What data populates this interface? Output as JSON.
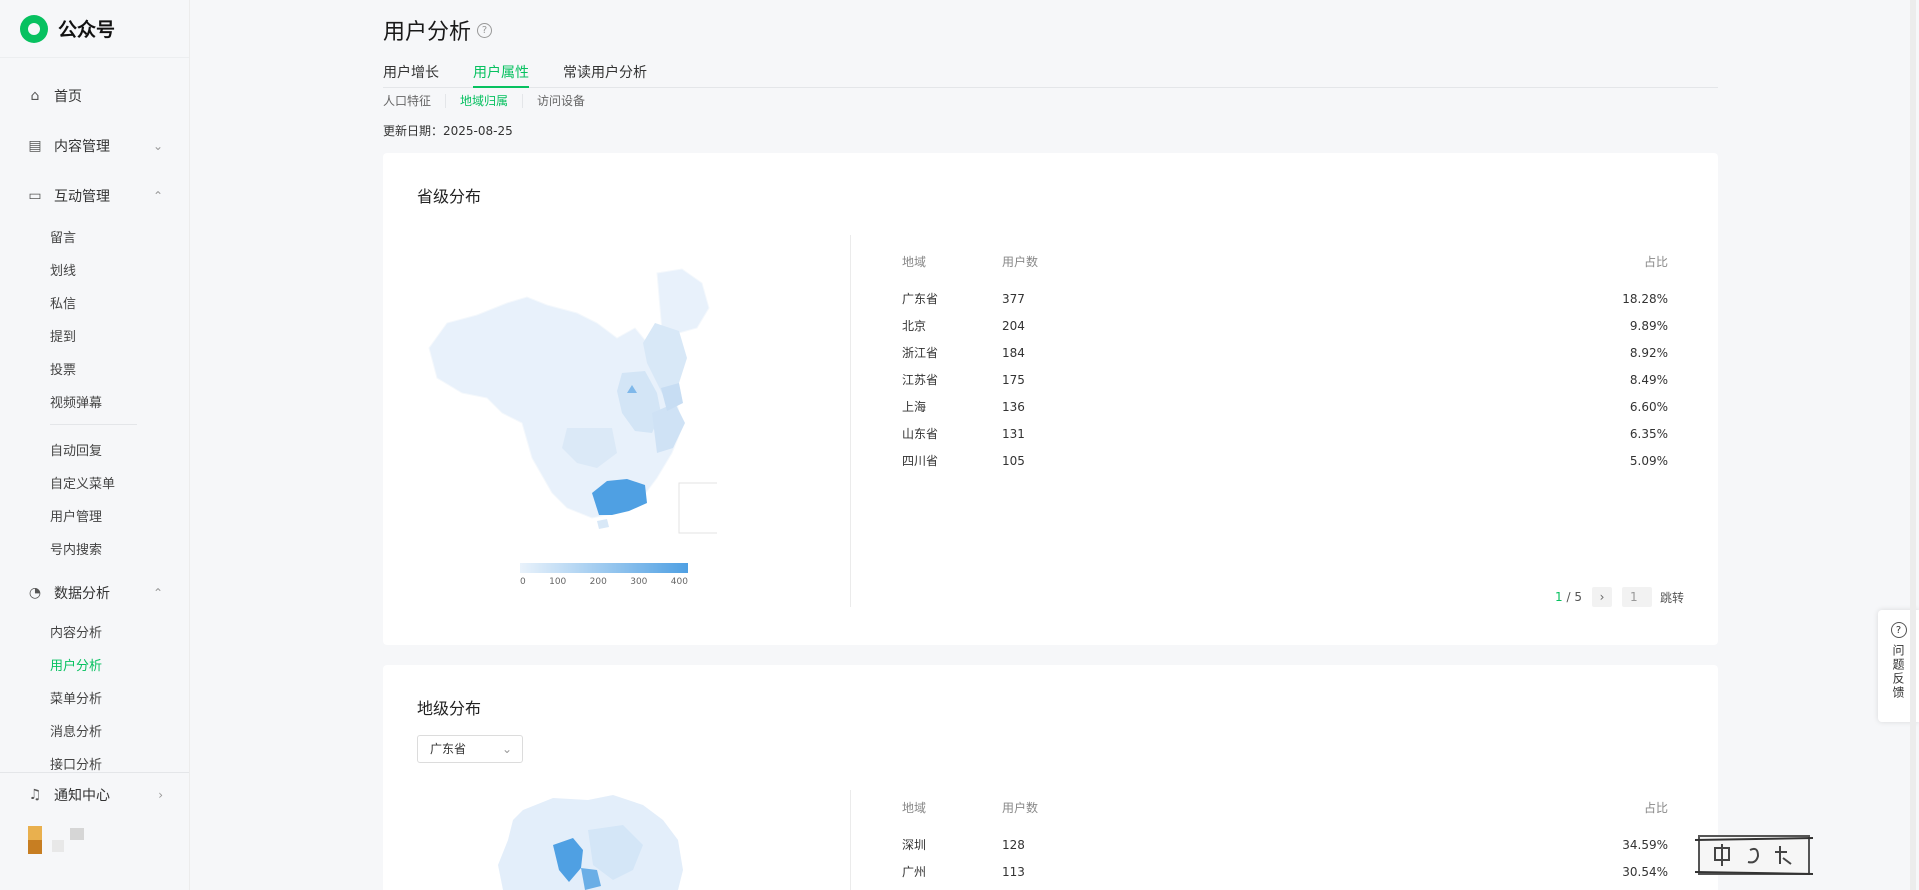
{
  "app": {
    "title": "公众号"
  },
  "sidebar": {
    "home": "首页",
    "content_mgmt": "内容管理",
    "interaction_mgmt": "互动管理",
    "interaction_items": [
      "留言",
      "划线",
      "私信",
      "提到",
      "投票",
      "视频弹幕"
    ],
    "tools_items": [
      "自动回复",
      "自定义菜单",
      "用户管理",
      "号内搜索"
    ],
    "data_analysis": "数据分析",
    "data_items": [
      "内容分析",
      "用户分析",
      "菜单分析",
      "消息分析",
      "接口分析"
    ],
    "active_item": "用户分析",
    "notifications": "通知中心"
  },
  "header": {
    "title": "用户分析",
    "tabs": [
      "用户增长",
      "用户属性",
      "常读用户分析"
    ],
    "active_tab": "用户属性",
    "subtabs": [
      "人口特征",
      "地域归属",
      "访问设备"
    ],
    "active_subtab": "地域归属",
    "update_date_label": "更新日期：",
    "update_date": "2025-08-25"
  },
  "province_card": {
    "title": "省级分布",
    "legend_ticks": [
      "0",
      "100",
      "200",
      "300",
      "400"
    ],
    "table_headers": {
      "region": "地域",
      "users": "用户数",
      "ratio": "占比"
    },
    "rows": [
      {
        "region": "广东省",
        "users": "377",
        "ratio": "18.28%"
      },
      {
        "region": "北京",
        "users": "204",
        "ratio": "9.89%"
      },
      {
        "region": "浙江省",
        "users": "184",
        "ratio": "8.92%"
      },
      {
        "region": "江苏省",
        "users": "175",
        "ratio": "8.49%"
      },
      {
        "region": "上海",
        "users": "136",
        "ratio": "6.60%"
      },
      {
        "region": "山东省",
        "users": "131",
        "ratio": "6.35%"
      },
      {
        "region": "四川省",
        "users": "105",
        "ratio": "5.09%"
      }
    ],
    "pager": {
      "current": "1",
      "total": "/ 5",
      "input": "1",
      "jump": "跳转"
    }
  },
  "city_card": {
    "title": "地级分布",
    "select_value": "广东省",
    "table_headers": {
      "region": "地域",
      "users": "用户数",
      "ratio": "占比"
    },
    "rows": [
      {
        "region": "深圳",
        "users": "128",
        "ratio": "34.59%"
      },
      {
        "region": "广州",
        "users": "113",
        "ratio": "30.54%"
      }
    ]
  },
  "feedback": {
    "label": "问题反馈"
  },
  "colors": {
    "accent": "#07c160",
    "map_high": "#4fa0e3",
    "map_low": "#e9f2fb"
  }
}
